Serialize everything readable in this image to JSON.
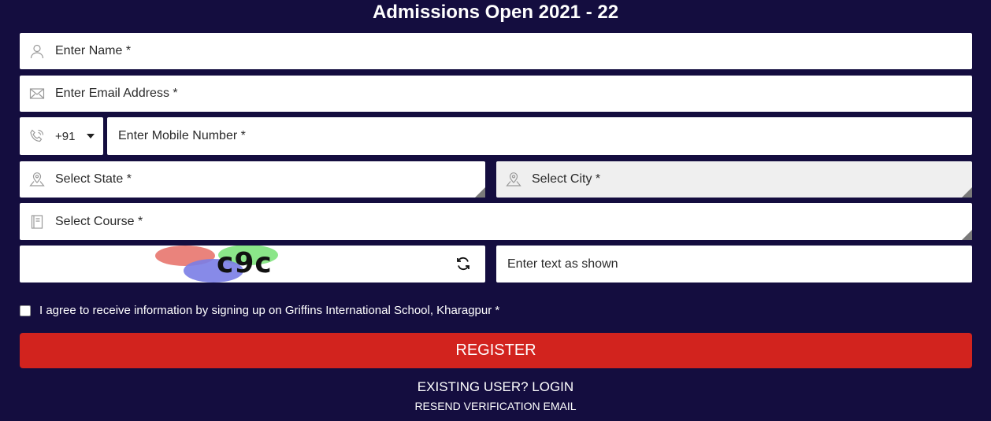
{
  "header": {
    "title": "Admissions Open 2021 - 22"
  },
  "form": {
    "name_placeholder": "Enter Name *",
    "email_placeholder": "Enter Email Address *",
    "country_code": "+91",
    "mobile_placeholder": "Enter Mobile Number *",
    "state_placeholder": "Select State *",
    "city_placeholder": "Select City *",
    "course_placeholder": "Select Course *",
    "captcha_text": "c9c",
    "captcha_input_placeholder": "Enter text as shown",
    "consent_label": "I agree to receive information by signing up on Griffins International School, Kharagpur *",
    "register_label": "REGISTER",
    "login_label": "EXISTING USER? LOGIN",
    "resend_label": "RESEND VERIFICATION EMAIL"
  },
  "icons": {
    "name": "user-icon",
    "email": "envelope-icon",
    "phone": "phone-icon",
    "state": "map-pin-icon",
    "city": "map-pin-icon",
    "course": "book-icon",
    "refresh": "refresh-icon",
    "country_dropdown": "caret-down-icon"
  },
  "colors": {
    "background": "#140d3f",
    "register_button": "#d2231e",
    "field_bg": "#ffffff",
    "disabled_field_bg": "#efefef"
  }
}
